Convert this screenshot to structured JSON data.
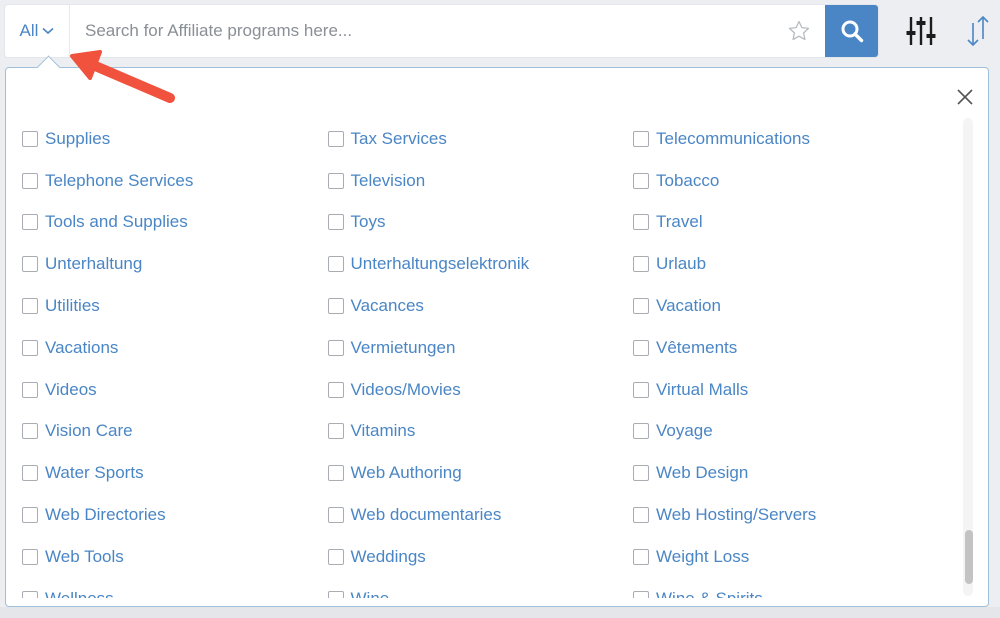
{
  "search": {
    "scope_label": "All",
    "placeholder": "Search for Affiliate programs here...",
    "value": ""
  },
  "icons": {
    "scope": "chevron-down-icon",
    "favorite": "star-icon",
    "search": "search-icon",
    "filter": "sliders-icon",
    "sort": "sort-icon",
    "close": "close-icon",
    "pointer": "red-arrow-icon"
  },
  "colors": {
    "accent": "#4a86c5",
    "panel_border": "#9fbfdc",
    "arrow": "#f0523d"
  },
  "categories": [
    {
      "label": "Supplies",
      "checked": false
    },
    {
      "label": "Tax Services",
      "checked": false
    },
    {
      "label": "Telecommunications",
      "checked": false
    },
    {
      "label": "Telephone Services",
      "checked": false
    },
    {
      "label": "Television",
      "checked": false
    },
    {
      "label": "Tobacco",
      "checked": false
    },
    {
      "label": "Tools and Supplies",
      "checked": false
    },
    {
      "label": "Toys",
      "checked": false
    },
    {
      "label": "Travel",
      "checked": false
    },
    {
      "label": "Unterhaltung",
      "checked": false
    },
    {
      "label": "Unterhaltungselektronik",
      "checked": false
    },
    {
      "label": "Urlaub",
      "checked": false
    },
    {
      "label": "Utilities",
      "checked": false
    },
    {
      "label": "Vacances",
      "checked": false
    },
    {
      "label": "Vacation",
      "checked": false
    },
    {
      "label": "Vacations",
      "checked": false
    },
    {
      "label": "Vermietungen",
      "checked": false
    },
    {
      "label": "Vêtements",
      "checked": false
    },
    {
      "label": "Videos",
      "checked": false
    },
    {
      "label": "Videos/Movies",
      "checked": false
    },
    {
      "label": "Virtual Malls",
      "checked": false
    },
    {
      "label": "Vision Care",
      "checked": false
    },
    {
      "label": "Vitamins",
      "checked": false
    },
    {
      "label": "Voyage",
      "checked": false
    },
    {
      "label": "Water Sports",
      "checked": false
    },
    {
      "label": "Web Authoring",
      "checked": false
    },
    {
      "label": "Web Design",
      "checked": false
    },
    {
      "label": "Web Directories",
      "checked": false
    },
    {
      "label": "Web documentaries",
      "checked": false
    },
    {
      "label": "Web Hosting/Servers",
      "checked": false
    },
    {
      "label": "Web Tools",
      "checked": false
    },
    {
      "label": "Weddings",
      "checked": false
    },
    {
      "label": "Weight Loss",
      "checked": false
    },
    {
      "label": "Wellness",
      "checked": false
    },
    {
      "label": "Wine",
      "checked": false
    },
    {
      "label": "Wine & Spirits",
      "checked": false
    }
  ]
}
